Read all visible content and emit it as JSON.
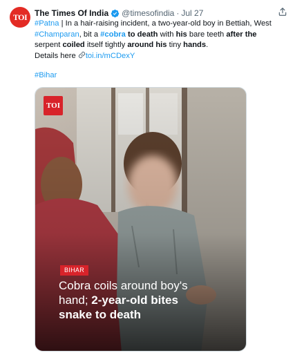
{
  "account": {
    "avatar_text": "TOI",
    "display_name": "The Times Of India",
    "handle": "@timesofindia",
    "separator": "·",
    "date": "Jul 27"
  },
  "tweet": {
    "segments": [
      {
        "text": "#Patna",
        "style": "tag"
      },
      {
        "text": " | In a hair-raising incident, a two-year-old boy in Bettiah, West ",
        "style": "plain"
      },
      {
        "text": "#Champaran",
        "style": "tag"
      },
      {
        "text": ", bit a ",
        "style": "plain"
      },
      {
        "text": "#cobra",
        "style": "tagbold"
      },
      {
        "text": " to death",
        "style": "bold"
      },
      {
        "text": " with ",
        "style": "plain"
      },
      {
        "text": "his",
        "style": "bold"
      },
      {
        "text": " bare teeth ",
        "style": "plain"
      },
      {
        "text": "after the",
        "style": "bold"
      },
      {
        "text": " serpent ",
        "style": "plain"
      },
      {
        "text": "coiled",
        "style": "bold"
      },
      {
        "text": " itself tightly ",
        "style": "plain"
      },
      {
        "text": "around his",
        "style": "bold"
      },
      {
        "text": " tiny ",
        "style": "plain"
      },
      {
        "text": "hands",
        "style": "bold"
      },
      {
        "text": ".",
        "style": "plain"
      }
    ],
    "details_label": "Details here ",
    "link_text": "toi.in/mCDexY",
    "hashtag": "#Bihar"
  },
  "media": {
    "badge": "TOI",
    "category": "BIHAR",
    "headline_line1": "Cobra coils around boy's",
    "headline_line2_plain": "hand; ",
    "headline_line2_bold": "2-year-old bites",
    "headline_line3_bold": "snake to death"
  },
  "colors": {
    "link": "#1d9bf0",
    "brand_red": "#d8232a",
    "verified": "#1d9bf0",
    "muted": "#536471"
  },
  "icons": [
    "verified-badge-icon",
    "share-icon",
    "link-icon"
  ]
}
